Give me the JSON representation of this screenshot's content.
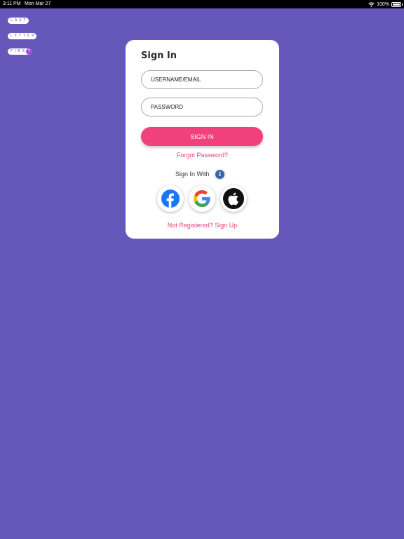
{
  "status_bar": {
    "time": "3:11 PM",
    "date": "Mon Mar 27",
    "battery": "100%"
  },
  "logo": {
    "row1": "LAST",
    "row2": "LETTER",
    "row3": "FIRS",
    "badge": "T"
  },
  "colors": {
    "background": "#6657ba",
    "accent": "#f0417d",
    "link": "#e5407c",
    "info": "#3b64a8"
  },
  "signin": {
    "title": "Sign In",
    "username_placeholder": "USERNAME/EMAIL",
    "password_placeholder": "PASSWORD",
    "button_label": "SIGN IN",
    "forgot_label": "Forgot Password?",
    "sign_in_with_label": "Sign In With",
    "info_icon": "i",
    "register_label": "Not Registered? Sign Up"
  },
  "social": [
    {
      "name": "facebook",
      "icon": "facebook-icon"
    },
    {
      "name": "google",
      "icon": "google-icon"
    },
    {
      "name": "apple",
      "icon": "apple-icon"
    }
  ]
}
